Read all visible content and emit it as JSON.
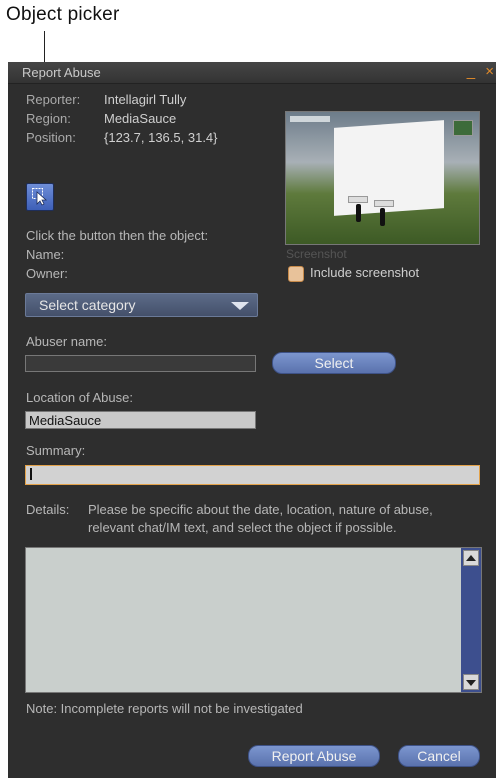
{
  "callout": {
    "label": "Object picker"
  },
  "window": {
    "title": "Report Abuse",
    "minimize_glyph": "_",
    "close_glyph": "×"
  },
  "info": {
    "reporter_label": "Reporter:",
    "reporter_value": "Intellagirl Tully",
    "region_label": "Region:",
    "region_value": "MediaSauce",
    "position_label": "Position:",
    "position_value": "{123.7, 136.5, 31.4}"
  },
  "picker": {
    "icon": "cursor-arrow-icon"
  },
  "screenshot": {
    "caption": "Screenshot",
    "include_label": "Include screenshot",
    "include_checked": false
  },
  "object": {
    "instruction": "Click the button then the object:",
    "name_label": "Name:",
    "owner_label": "Owner:"
  },
  "category": {
    "selected": "Select category"
  },
  "abuser": {
    "label": "Abuser name:",
    "value": "",
    "select_button": "Select"
  },
  "location": {
    "label": "Location of Abuse:",
    "value": "MediaSauce"
  },
  "summary": {
    "label": "Summary:",
    "value": ""
  },
  "details": {
    "label": "Details:",
    "instruction_line1": "Please be specific about the date, location, nature of abuse,",
    "instruction_line2": "relevant chat/IM text, and select the object if possible."
  },
  "note": "Note: Incomplete reports will not be investigated",
  "buttons": {
    "report": "Report Abuse",
    "cancel": "Cancel"
  },
  "colors": {
    "panel_bg": "#2e2e2e",
    "accent_orange": "#e08a2a",
    "button_blue": "#6b84c0"
  }
}
